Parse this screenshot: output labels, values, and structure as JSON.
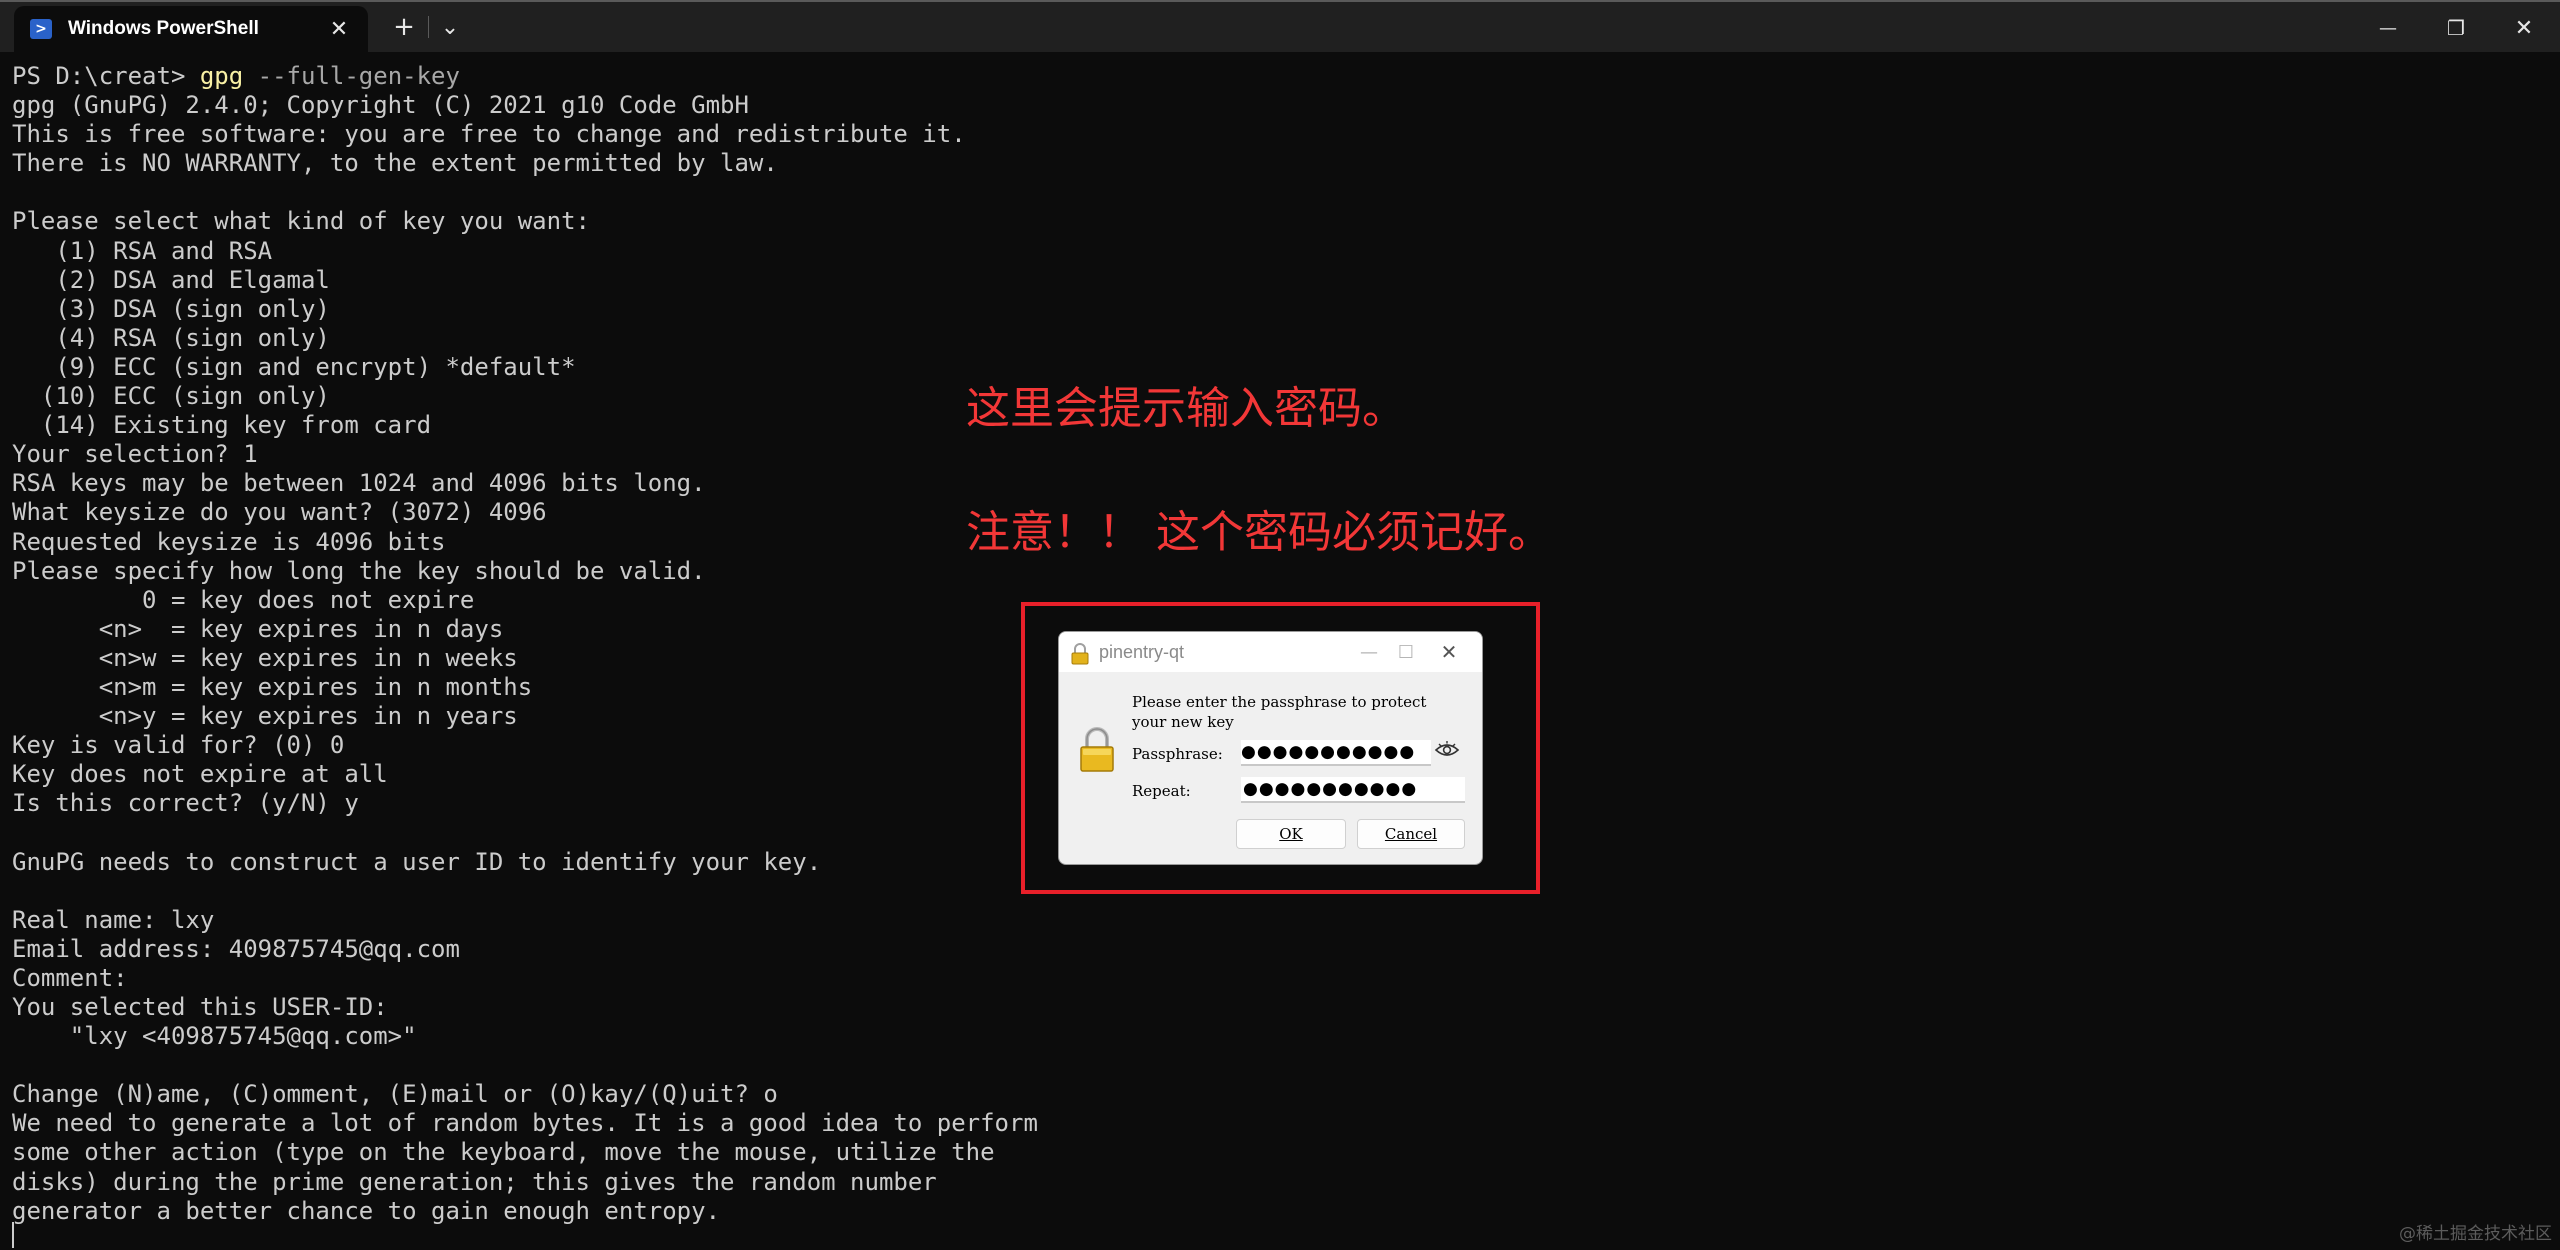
{
  "window": {
    "tab_title": "Windows PowerShell",
    "tab_icon": "powershell-icon",
    "new_tab_glyph": "+",
    "dropdown_glyph": "⌄",
    "minimize_glyph": "—",
    "maximize_glyph": "❐",
    "close_glyph": "✕",
    "tab_close_glyph": "✕"
  },
  "terminal": {
    "prompt": "PS D:\\creat> ",
    "command_name": "gpg",
    "command_args": " --full-gen-key",
    "output": "gpg (GnuPG) 2.4.0; Copyright (C) 2021 g10 Code GmbH\nThis is free software: you are free to change and redistribute it.\nThere is NO WARRANTY, to the extent permitted by law.\n\nPlease select what kind of key you want:\n   (1) RSA and RSA\n   (2) DSA and Elgamal\n   (3) DSA (sign only)\n   (4) RSA (sign only)\n   (9) ECC (sign and encrypt) *default*\n  (10) ECC (sign only)\n  (14) Existing key from card\nYour selection? 1\nRSA keys may be between 1024 and 4096 bits long.\nWhat keysize do you want? (3072) 4096\nRequested keysize is 4096 bits\nPlease specify how long the key should be valid.\n         0 = key does not expire\n      <n>  = key expires in n days\n      <n>w = key expires in n weeks\n      <n>m = key expires in n months\n      <n>y = key expires in n years\nKey is valid for? (0) 0\nKey does not expire at all\nIs this correct? (y/N) y\n\nGnuPG needs to construct a user ID to identify your key.\n\nReal name: lxy\nEmail address: 409875745@qq.com\nComment:\nYou selected this USER-ID:\n    \"lxy <409875745@qq.com>\"\n\nChange (N)ame, (C)omment, (E)mail or (O)kay/(Q)uit? o\nWe need to generate a lot of random bytes. It is a good idea to perform\nsome other action (type on the keyboard, move the mouse, utilize the\ndisks) during the prime generation; this gives the random number\ngenerator a better chance to gain enough entropy."
  },
  "annotations": {
    "line1": "这里会提示输入密码。",
    "line2": "注意！！ 这个密码必须记好。",
    "color": "#f23737"
  },
  "dialog": {
    "title": "pinentry-qt",
    "message": "Please enter the passphrase to protect your new key",
    "passphrase_label": "Passphrase:",
    "passphrase_value": "●●●●●●●●●●●",
    "repeat_label": "Repeat:",
    "repeat_value": "●●●●●●●●●●●",
    "ok_label": "OK",
    "cancel_label": "Cancel",
    "minimize_glyph": "—",
    "maximize_glyph": "☐",
    "close_glyph": "✕"
  },
  "watermark": "@稀土掘金技术社区"
}
